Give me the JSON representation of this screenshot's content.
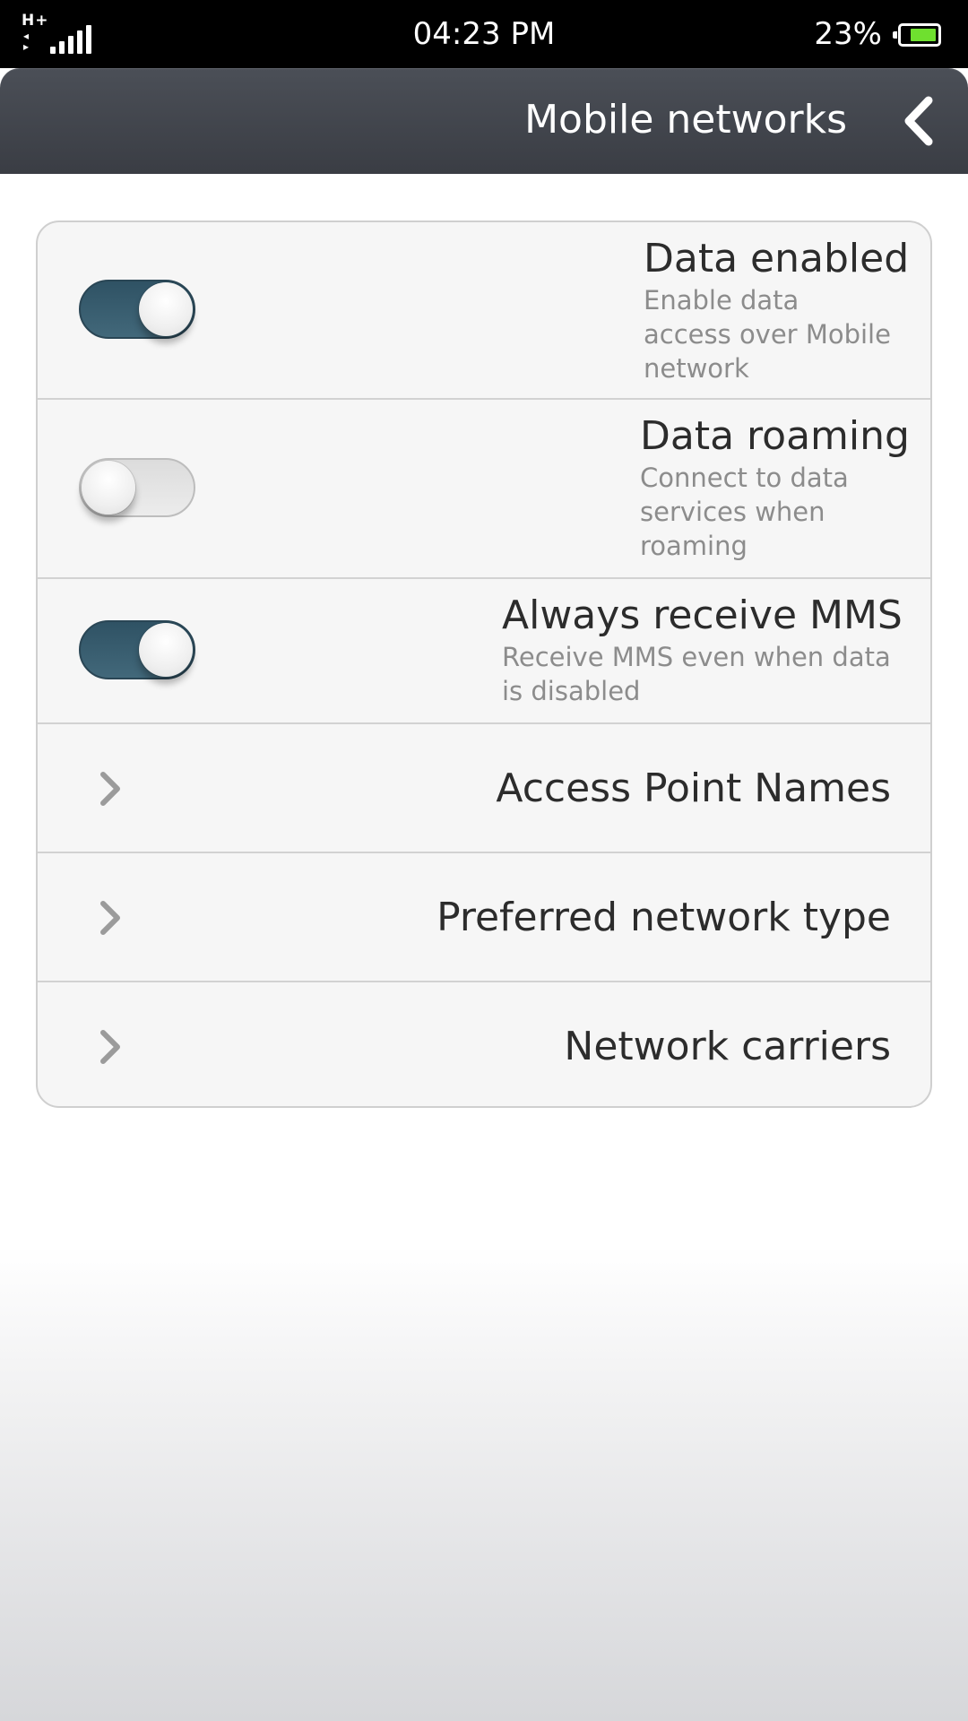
{
  "status_bar": {
    "network_type": "H+",
    "signal_icon": "signal-bars-icon",
    "time": "04:23 PM",
    "battery_percent": "23%",
    "battery_level": 0.23,
    "battery_color": "#6fe02f"
  },
  "title_bar": {
    "title": "Mobile networks",
    "back_icon": "chevron-left-icon"
  },
  "settings": {
    "toggles": [
      {
        "title": "Data enabled",
        "description": "Enable data access over Mobile network",
        "on": true
      },
      {
        "title": "Data roaming",
        "description": "Connect to data services when roaming",
        "on": false
      },
      {
        "title": "Always receive MMS",
        "description": "Receive MMS even when data is disabled",
        "on": true
      }
    ],
    "nav_items": [
      {
        "label": "Access Point Names",
        "icon": "chevron-right-icon"
      },
      {
        "label": "Preferred network type",
        "icon": "chevron-right-icon"
      },
      {
        "label": "Network carriers",
        "icon": "chevron-right-icon"
      }
    ]
  },
  "colors": {
    "toggle_on": "#2f5264",
    "title_bar": "#3a3d44",
    "card_background": "#f6f6f6"
  }
}
